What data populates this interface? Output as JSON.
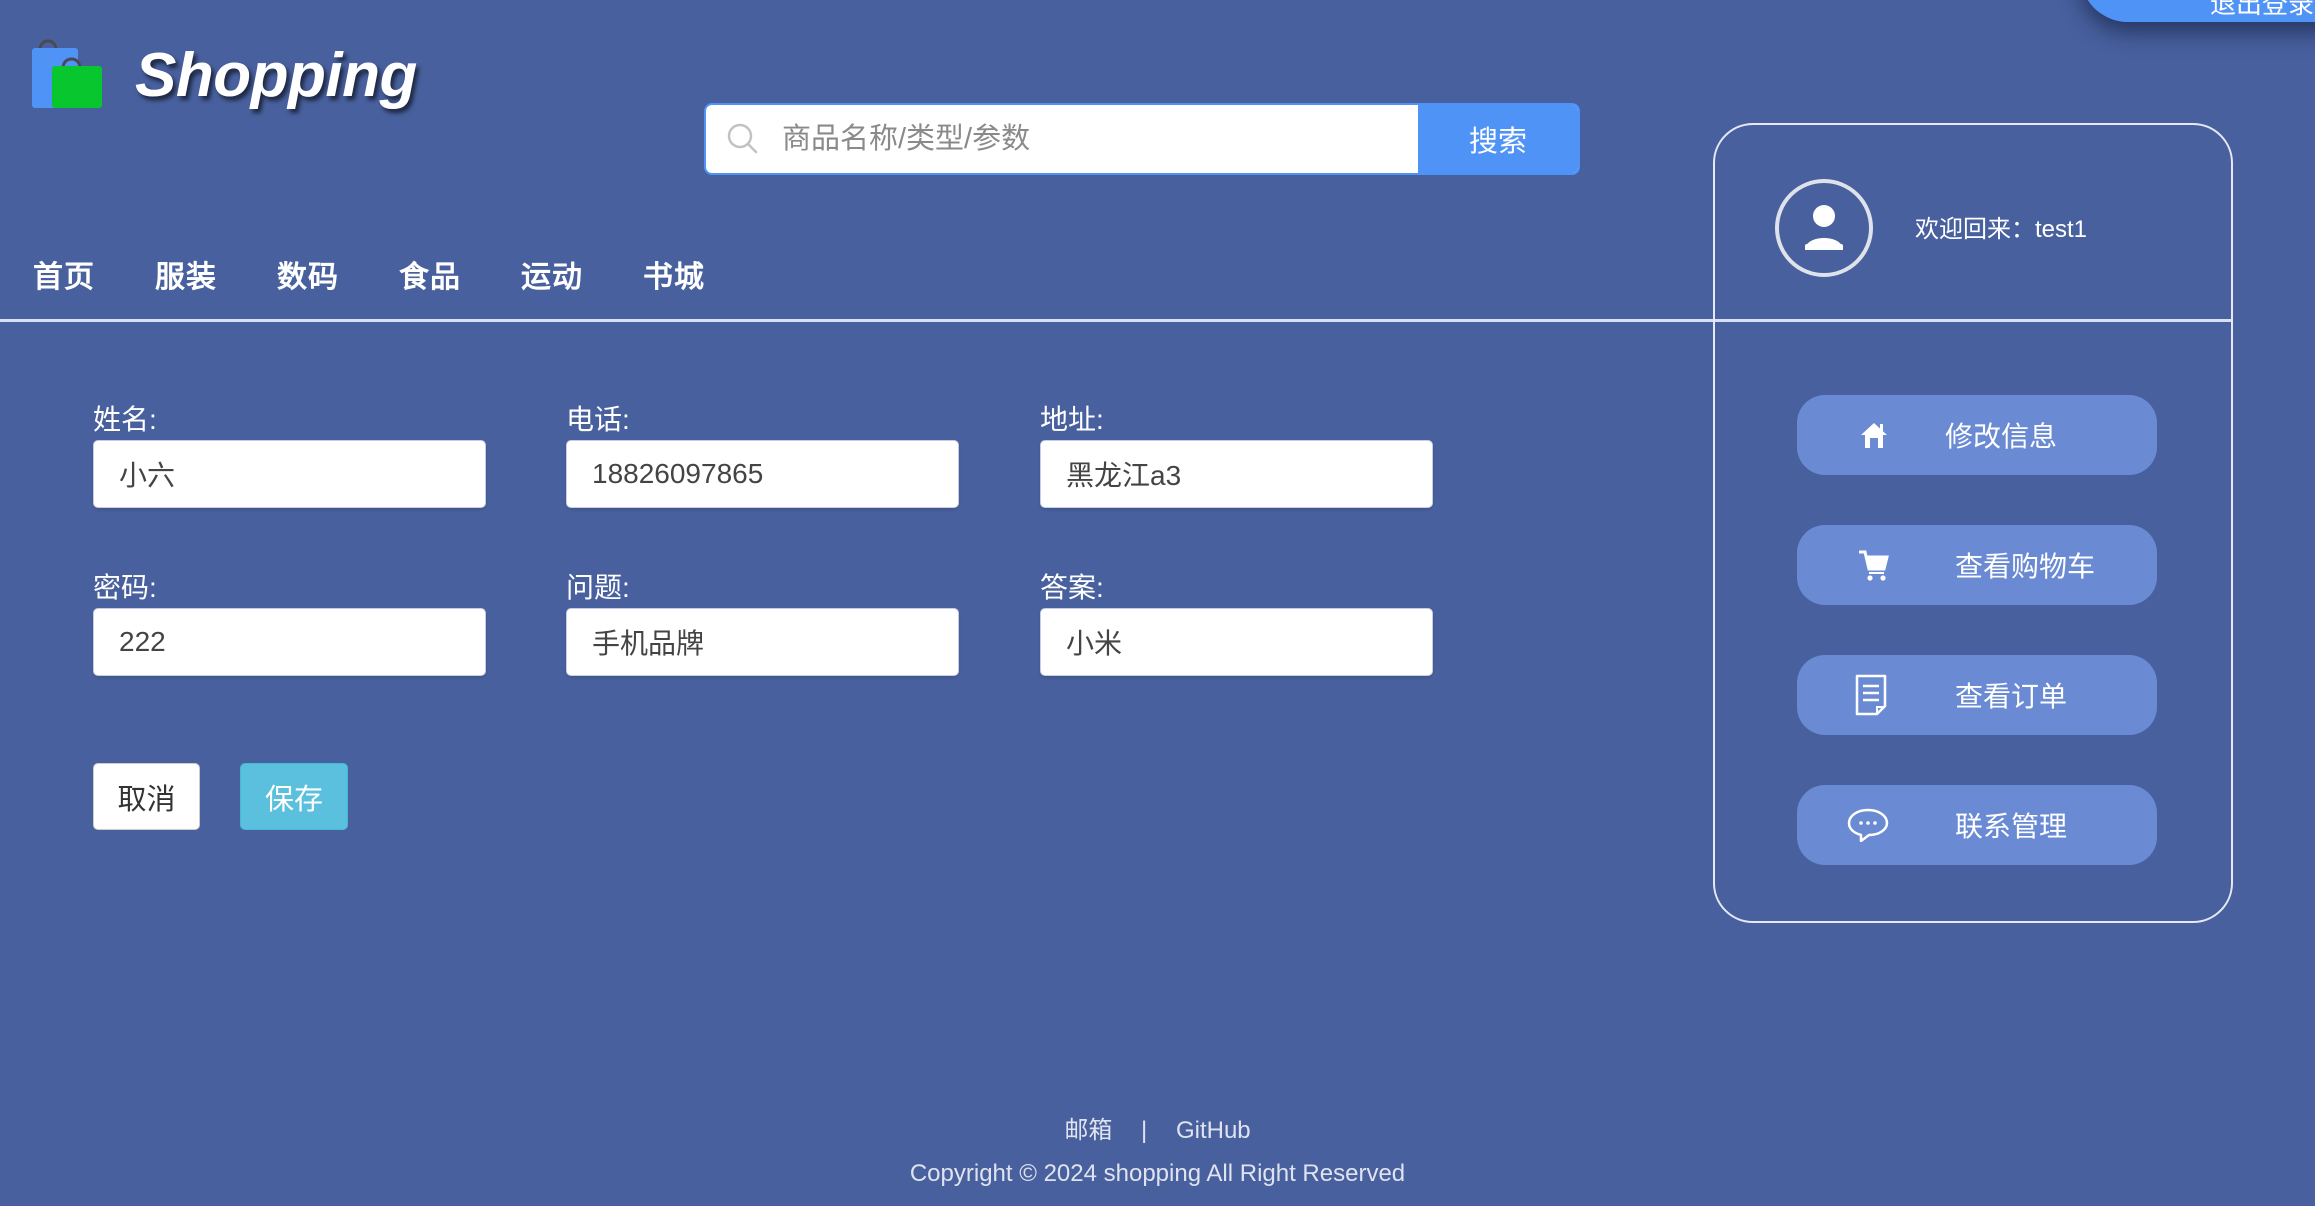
{
  "header": {
    "brand": "Shopping",
    "logout_label": "退出登录",
    "search": {
      "placeholder": "商品名称/类型/参数",
      "value": "",
      "button_label": "搜索"
    }
  },
  "nav": {
    "items": [
      {
        "label": "首页"
      },
      {
        "label": "服装"
      },
      {
        "label": "数码"
      },
      {
        "label": "食品"
      },
      {
        "label": "运动"
      },
      {
        "label": "书城"
      }
    ]
  },
  "form": {
    "fields": [
      {
        "label": "姓名:",
        "value": "小六"
      },
      {
        "label": "电话:",
        "value": "18826097865"
      },
      {
        "label": "地址:",
        "value": "黑龙江a3"
      },
      {
        "label": "密码:",
        "value": "222"
      },
      {
        "label": "问题:",
        "value": "手机品牌"
      },
      {
        "label": "答案:",
        "value": "小米"
      }
    ],
    "cancel_label": "取消",
    "save_label": "保存"
  },
  "user_card": {
    "welcome": "欢迎回来：test1",
    "menu": [
      {
        "label": "修改信息",
        "icon": "home-icon"
      },
      {
        "label": "查看购物车",
        "icon": "cart-icon"
      },
      {
        "label": "查看订单",
        "icon": "order-document-icon"
      },
      {
        "label": "联系管理",
        "icon": "chat-bubble-icon"
      }
    ]
  },
  "footer": {
    "links": [
      {
        "label": "邮箱"
      },
      {
        "label": "GitHub"
      }
    ],
    "separator": "|",
    "copyright": "Copyright © 2024 shopping All Right Reserved"
  },
  "colors": {
    "background": "#48609e",
    "primary_blue": "#4f93f7",
    "menu_button": "#6a8bd3",
    "save_button": "#5bc0de",
    "logo_bag_blue": "#4f93f7",
    "logo_bag_green": "#08c62e"
  }
}
